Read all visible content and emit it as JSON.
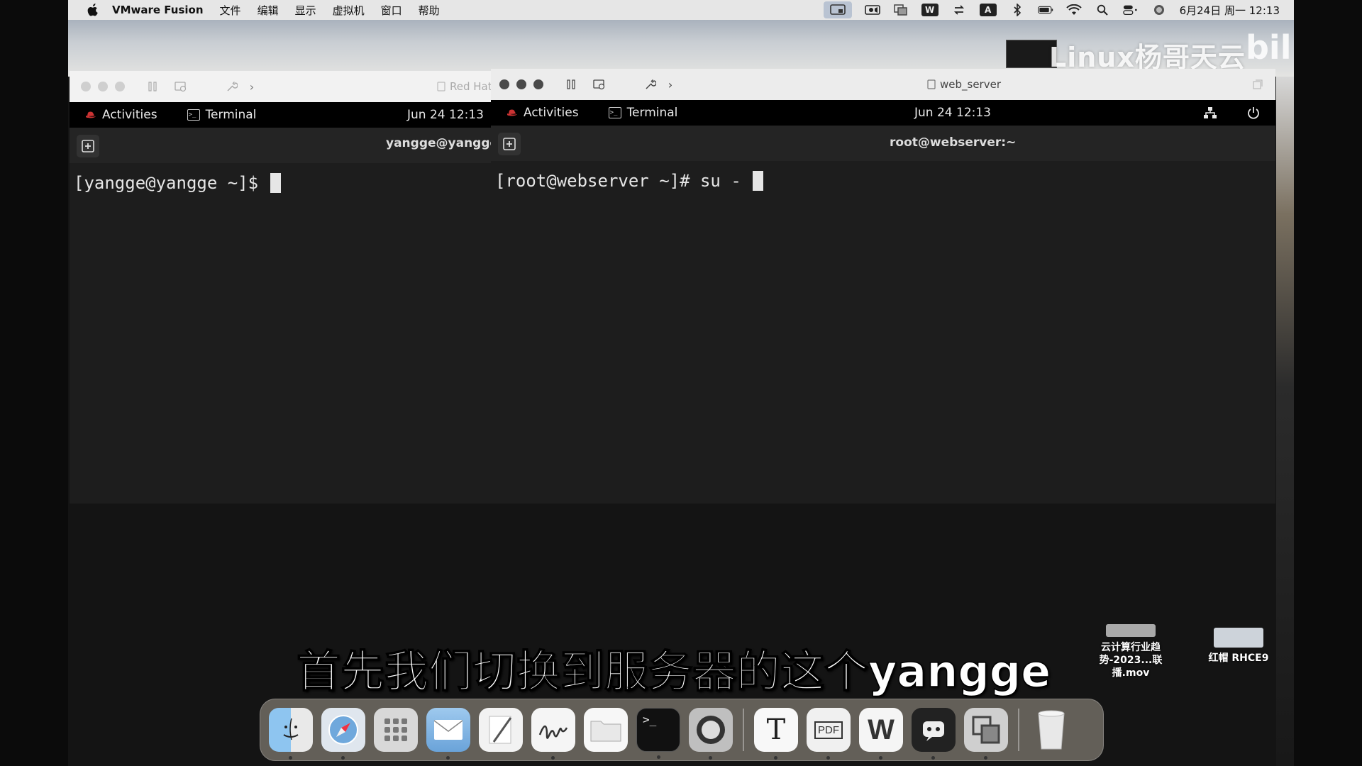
{
  "menubar": {
    "app_name": "VMware Fusion",
    "menus": [
      "文件",
      "编辑",
      "显示",
      "虚拟机",
      "窗口",
      "帮助"
    ],
    "clock": "6月24日 周一  12:13",
    "status_icons": [
      "vm-display-icon",
      "screen-record-icon",
      "vmware-icon",
      "wps-icon",
      "sync-icon",
      "input-method-icon",
      "bluetooth-icon",
      "battery-icon",
      "wifi-icon",
      "search-icon",
      "control-center-icon",
      "siri-icon"
    ],
    "input_method_label": "A",
    "wps_label": "W"
  },
  "watermark": {
    "text": "Linux杨哥天云",
    "logo": "bilibili"
  },
  "back_window": {
    "title": "Red Hat",
    "activities": "Activities",
    "terminal": "Terminal",
    "clock": "Jun 24  12:13",
    "terminal_title": "yangge@yangge:",
    "prompt": "[yangge@yangge ~]$ "
  },
  "front_window": {
    "title": "web_server",
    "activities": "Activities",
    "terminal": "Terminal",
    "clock": "Jun 24  12:13",
    "terminal_title": "root@webserver:~",
    "prompt": "[root@webserver ~]# su - "
  },
  "desktop_files": [
    {
      "label_line1": "云计算行业趋",
      "label_line2": "势-2023...联播.mov"
    },
    {
      "label_line1": "红帽 RHCE9",
      "label_line2": ""
    }
  ],
  "subtitle": "首先我们切换到服务器的这个yangge",
  "dock": {
    "apps": [
      "finder-icon",
      "safari-icon",
      "launchpad-icon",
      "mail-icon",
      "textedit-icon",
      "freeform-icon",
      "folder-icon",
      "terminal-icon",
      "screenshot-icon",
      "typora-icon",
      "pdf-expert-icon",
      "wps-icon",
      "chatbot-icon",
      "vmware-fusion-icon",
      "trash-icon"
    ],
    "typora_glyph": "T",
    "pdf_glyph": "PDF",
    "wps_glyph": "W",
    "terminal_glyph": ">_"
  }
}
